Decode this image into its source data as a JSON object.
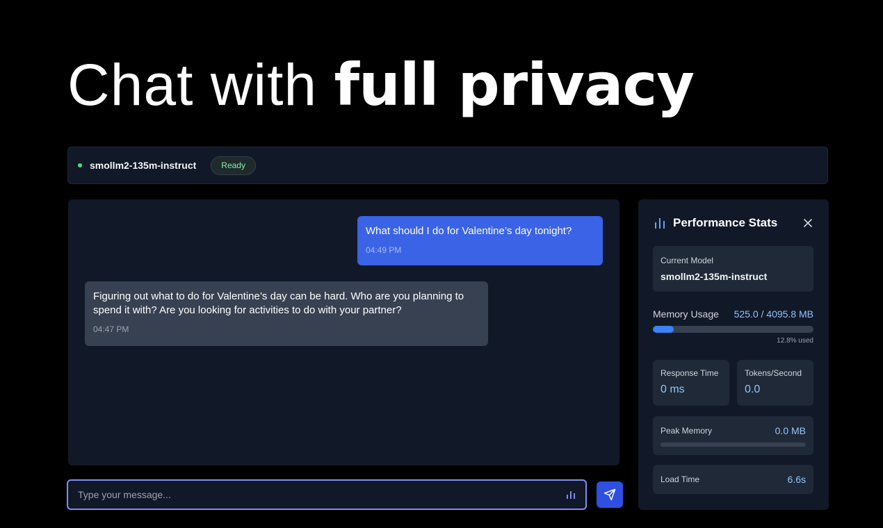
{
  "hero": {
    "text_light": "Chat with ",
    "text_bold": "full privacy"
  },
  "status_bar": {
    "model_name": "smollm2-135m-instruct",
    "status": "Ready"
  },
  "messages": [
    {
      "role": "user",
      "text": "What should I do for Valentine’s day tonight?",
      "time": "04:49 PM"
    },
    {
      "role": "assistant",
      "text": "Figuring out what to do for Valentine’s day can be hard. Who are you planning to spend it with? Are you looking for activities to do with your partner?",
      "time": "04:47 PM"
    }
  ],
  "input": {
    "placeholder": "Type your message...",
    "value": ""
  },
  "stats": {
    "title": "Performance Stats",
    "current_model_label": "Current Model",
    "current_model": "smollm2-135m-instruct",
    "memory_label": "Memory Usage",
    "memory_value": "525.0 / 4095.8 MB",
    "memory_fraction": 0.128,
    "memory_pct_text": "12.8% used",
    "response_time_label": "Response Time",
    "response_time": "0 ms",
    "tokens_label": "Tokens/Second",
    "tokens": "0.0",
    "peak_label": "Peak Memory",
    "peak_value": "0.0 MB",
    "peak_fraction": 0,
    "load_label": "Load Time",
    "load_value": "6.6s"
  },
  "colors": {
    "accent": "#3b63e6",
    "ready": "#86efac",
    "value_blue": "#93c5fd"
  }
}
